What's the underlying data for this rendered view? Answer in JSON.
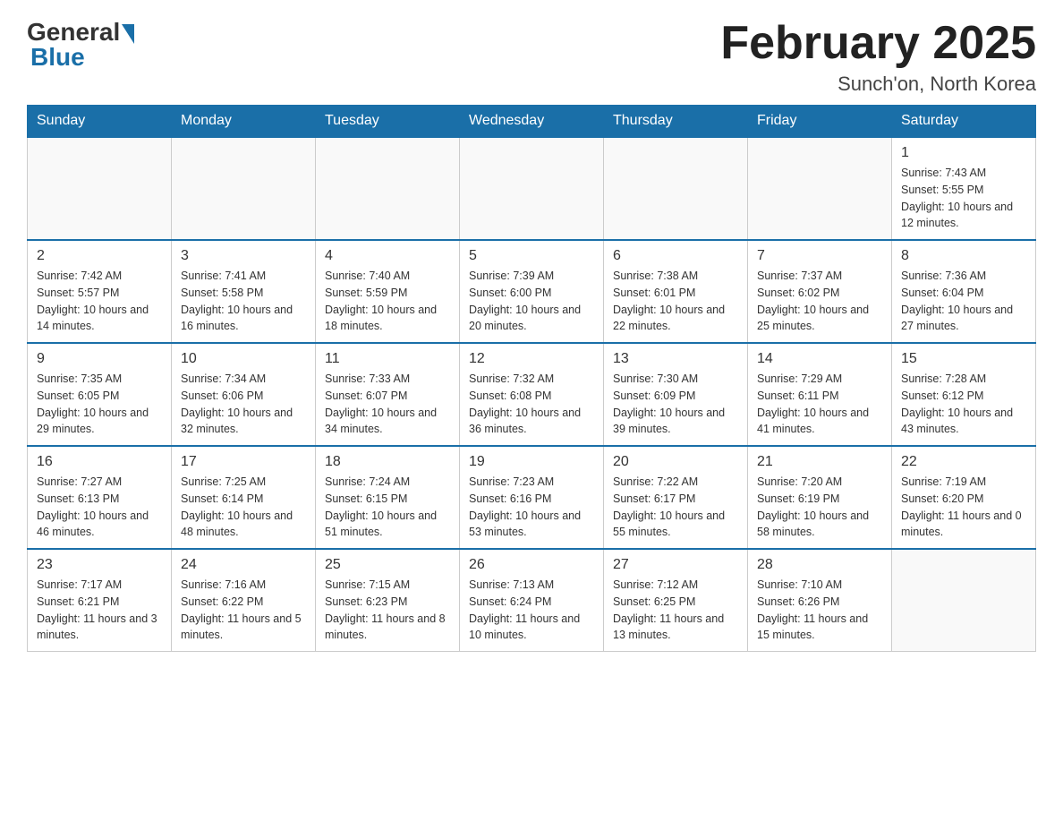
{
  "logo": {
    "general": "General",
    "blue": "Blue"
  },
  "header": {
    "title": "February 2025",
    "location": "Sunch'on, North Korea"
  },
  "days_of_week": [
    "Sunday",
    "Monday",
    "Tuesday",
    "Wednesday",
    "Thursday",
    "Friday",
    "Saturday"
  ],
  "weeks": [
    [
      {
        "day": "",
        "info": ""
      },
      {
        "day": "",
        "info": ""
      },
      {
        "day": "",
        "info": ""
      },
      {
        "day": "",
        "info": ""
      },
      {
        "day": "",
        "info": ""
      },
      {
        "day": "",
        "info": ""
      },
      {
        "day": "1",
        "info": "Sunrise: 7:43 AM\nSunset: 5:55 PM\nDaylight: 10 hours and 12 minutes."
      }
    ],
    [
      {
        "day": "2",
        "info": "Sunrise: 7:42 AM\nSunset: 5:57 PM\nDaylight: 10 hours and 14 minutes."
      },
      {
        "day": "3",
        "info": "Sunrise: 7:41 AM\nSunset: 5:58 PM\nDaylight: 10 hours and 16 minutes."
      },
      {
        "day": "4",
        "info": "Sunrise: 7:40 AM\nSunset: 5:59 PM\nDaylight: 10 hours and 18 minutes."
      },
      {
        "day": "5",
        "info": "Sunrise: 7:39 AM\nSunset: 6:00 PM\nDaylight: 10 hours and 20 minutes."
      },
      {
        "day": "6",
        "info": "Sunrise: 7:38 AM\nSunset: 6:01 PM\nDaylight: 10 hours and 22 minutes."
      },
      {
        "day": "7",
        "info": "Sunrise: 7:37 AM\nSunset: 6:02 PM\nDaylight: 10 hours and 25 minutes."
      },
      {
        "day": "8",
        "info": "Sunrise: 7:36 AM\nSunset: 6:04 PM\nDaylight: 10 hours and 27 minutes."
      }
    ],
    [
      {
        "day": "9",
        "info": "Sunrise: 7:35 AM\nSunset: 6:05 PM\nDaylight: 10 hours and 29 minutes."
      },
      {
        "day": "10",
        "info": "Sunrise: 7:34 AM\nSunset: 6:06 PM\nDaylight: 10 hours and 32 minutes."
      },
      {
        "day": "11",
        "info": "Sunrise: 7:33 AM\nSunset: 6:07 PM\nDaylight: 10 hours and 34 minutes."
      },
      {
        "day": "12",
        "info": "Sunrise: 7:32 AM\nSunset: 6:08 PM\nDaylight: 10 hours and 36 minutes."
      },
      {
        "day": "13",
        "info": "Sunrise: 7:30 AM\nSunset: 6:09 PM\nDaylight: 10 hours and 39 minutes."
      },
      {
        "day": "14",
        "info": "Sunrise: 7:29 AM\nSunset: 6:11 PM\nDaylight: 10 hours and 41 minutes."
      },
      {
        "day": "15",
        "info": "Sunrise: 7:28 AM\nSunset: 6:12 PM\nDaylight: 10 hours and 43 minutes."
      }
    ],
    [
      {
        "day": "16",
        "info": "Sunrise: 7:27 AM\nSunset: 6:13 PM\nDaylight: 10 hours and 46 minutes."
      },
      {
        "day": "17",
        "info": "Sunrise: 7:25 AM\nSunset: 6:14 PM\nDaylight: 10 hours and 48 minutes."
      },
      {
        "day": "18",
        "info": "Sunrise: 7:24 AM\nSunset: 6:15 PM\nDaylight: 10 hours and 51 minutes."
      },
      {
        "day": "19",
        "info": "Sunrise: 7:23 AM\nSunset: 6:16 PM\nDaylight: 10 hours and 53 minutes."
      },
      {
        "day": "20",
        "info": "Sunrise: 7:22 AM\nSunset: 6:17 PM\nDaylight: 10 hours and 55 minutes."
      },
      {
        "day": "21",
        "info": "Sunrise: 7:20 AM\nSunset: 6:19 PM\nDaylight: 10 hours and 58 minutes."
      },
      {
        "day": "22",
        "info": "Sunrise: 7:19 AM\nSunset: 6:20 PM\nDaylight: 11 hours and 0 minutes."
      }
    ],
    [
      {
        "day": "23",
        "info": "Sunrise: 7:17 AM\nSunset: 6:21 PM\nDaylight: 11 hours and 3 minutes."
      },
      {
        "day": "24",
        "info": "Sunrise: 7:16 AM\nSunset: 6:22 PM\nDaylight: 11 hours and 5 minutes."
      },
      {
        "day": "25",
        "info": "Sunrise: 7:15 AM\nSunset: 6:23 PM\nDaylight: 11 hours and 8 minutes."
      },
      {
        "day": "26",
        "info": "Sunrise: 7:13 AM\nSunset: 6:24 PM\nDaylight: 11 hours and 10 minutes."
      },
      {
        "day": "27",
        "info": "Sunrise: 7:12 AM\nSunset: 6:25 PM\nDaylight: 11 hours and 13 minutes."
      },
      {
        "day": "28",
        "info": "Sunrise: 7:10 AM\nSunset: 6:26 PM\nDaylight: 11 hours and 15 minutes."
      },
      {
        "day": "",
        "info": ""
      }
    ]
  ]
}
